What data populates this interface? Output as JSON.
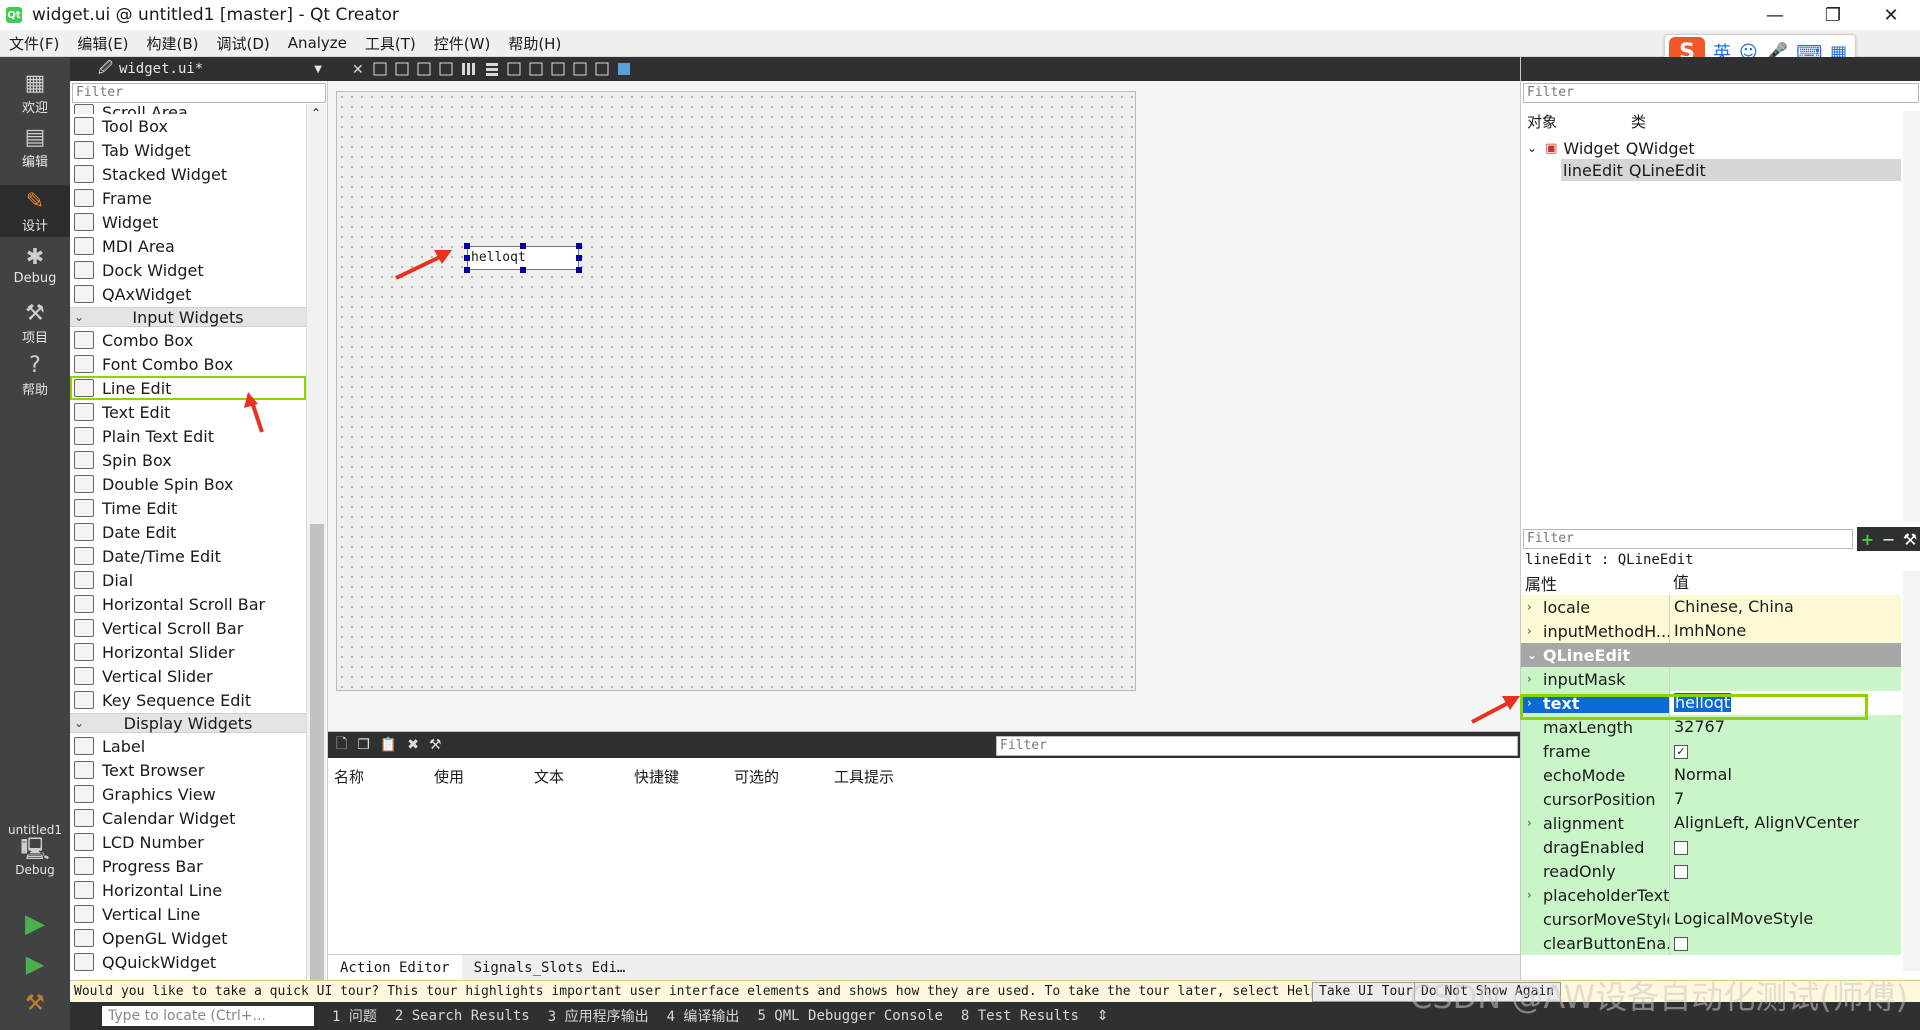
{
  "window": {
    "title": "widget.ui @ untitled1 [master] - Qt Creator",
    "controls": [
      "—",
      "❐",
      "✕"
    ]
  },
  "menu": [
    "文件(F)",
    "编辑(E)",
    "构建(B)",
    "调试(D)",
    "Analyze",
    "工具(T)",
    "控件(W)",
    "帮助(H)"
  ],
  "modes": [
    {
      "label": "欢迎",
      "icon": "grid-icon"
    },
    {
      "label": "编辑",
      "icon": "edit-icon"
    },
    {
      "label": "设计",
      "icon": "pencil-icon"
    },
    {
      "label": "Debug",
      "icon": "bug-icon"
    },
    {
      "label": "项目",
      "icon": "wrench-icon"
    },
    {
      "label": "帮助",
      "icon": "help-icon"
    }
  ],
  "kit": {
    "project": "untitled1",
    "config": "Debug"
  },
  "editor_tab": {
    "name": "widget.ui*"
  },
  "widget_box": {
    "filter_placeholder": "Filter",
    "partial_item": "Scroll Area",
    "container_items": [
      "Tool Box",
      "Tab Widget",
      "Stacked Widget",
      "Frame",
      "Widget",
      "MDI Area",
      "Dock Widget",
      "QAxWidget"
    ],
    "input_category": "Input Widgets",
    "input_items": [
      "Combo Box",
      "Font Combo Box",
      "Line Edit",
      "Text Edit",
      "Plain Text Edit",
      "Spin Box",
      "Double Spin Box",
      "Time Edit",
      "Date Edit",
      "Date/Time Edit",
      "Dial",
      "Horizontal Scroll Bar",
      "Vertical Scroll Bar",
      "Horizontal Slider",
      "Vertical Slider",
      "Key Sequence Edit"
    ],
    "display_category": "Display Widgets",
    "display_items": [
      "Label",
      "Text Browser",
      "Graphics View",
      "Calendar Widget",
      "LCD Number",
      "Progress Bar",
      "Horizontal Line",
      "Vertical Line",
      "OpenGL Widget",
      "QQuickWidget"
    ]
  },
  "form": {
    "lineedit_text": "helloqt"
  },
  "action_editor": {
    "filter_placeholder": "Filter",
    "columns": [
      "名称",
      "使用",
      "文本",
      "快捷键",
      "可选的",
      "工具提示"
    ],
    "tabs": [
      "Action Editor",
      "Signals_Slots Edi…"
    ]
  },
  "object_inspector": {
    "filter_placeholder": "Filter",
    "columns": [
      "对象",
      "类"
    ],
    "rows": [
      {
        "object": "Widget",
        "class": "QWidget"
      },
      {
        "object": "lineEdit",
        "class": "QLineEdit"
      }
    ]
  },
  "property_editor": {
    "filter_placeholder": "Filter",
    "class_label": "lineEdit : QLineEdit",
    "columns": [
      "属性",
      "值"
    ],
    "section": "QLineEdit",
    "rows_before": [
      {
        "name": "locale",
        "value": "Chinese, China"
      },
      {
        "name": "inputMethodH...",
        "value": "ImhNone"
      }
    ],
    "rows_after": [
      {
        "name": "inputMask",
        "value": ""
      },
      {
        "name": "text",
        "value": "helloqt"
      },
      {
        "name": "maxLength",
        "value": "32767"
      },
      {
        "name": "frame",
        "value": "✓"
      },
      {
        "name": "echoMode",
        "value": "Normal"
      },
      {
        "name": "cursorPosition",
        "value": "7"
      },
      {
        "name": "alignment",
        "value": "AlignLeft, AlignVCenter"
      },
      {
        "name": "dragEnabled",
        "value": ""
      },
      {
        "name": "readOnly",
        "value": ""
      },
      {
        "name": "placeholderText",
        "value": ""
      },
      {
        "name": "cursorMoveStyle",
        "value": "LogicalMoveStyle"
      },
      {
        "name": "clearButtonEna...",
        "value": ""
      }
    ]
  },
  "tour": {
    "message": "Would you like to take a quick UI tour? This tour highlights important user interface elements and shows how they are used. To take the tour later, select Help > UI Tour.",
    "take_button": "Take UI Tour",
    "dismiss_button": "Do Not Show Again"
  },
  "status": {
    "locator_placeholder": "Type to locate (Ctrl+...",
    "items": [
      "1 问题",
      "2 Search Results",
      "3 应用程序输出",
      "4 编译输出",
      "5 QML Debugger Console",
      "8 Test Results"
    ]
  },
  "ime": {
    "mode": "英"
  },
  "watermark": "CSDN @AW设备自动化测试(师傅)",
  "colors": {
    "highlight_green": "#8bd400",
    "selection_blue": "#0a68d7",
    "annotation_red": "#e8311f",
    "mode_bar": "#404244"
  }
}
